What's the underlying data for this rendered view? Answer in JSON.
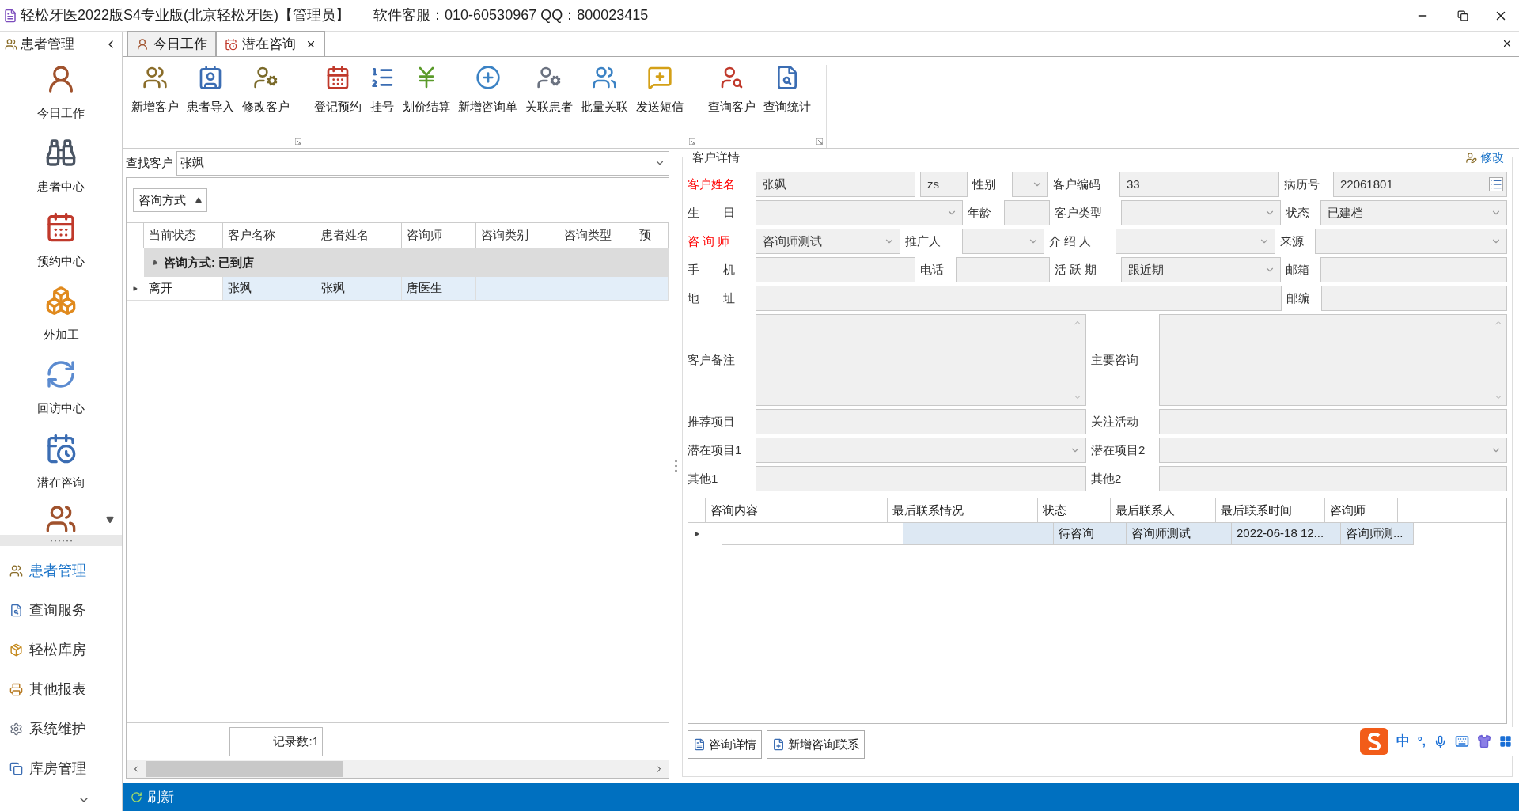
{
  "window": {
    "title": "轻松牙医2022版S4专业版(北京轻松牙医)【管理员】",
    "support": "软件客服：010-60530967 QQ：800023415"
  },
  "sidebar": {
    "title": "患者管理",
    "modules": [
      {
        "label": "今日工作"
      },
      {
        "label": "患者中心"
      },
      {
        "label": "预约中心"
      },
      {
        "label": "外加工"
      },
      {
        "label": "回访中心"
      },
      {
        "label": "潜在咨询"
      }
    ],
    "nav": [
      {
        "label": "患者管理",
        "selected": true
      },
      {
        "label": "查询服务",
        "selected": false
      },
      {
        "label": "轻松库房",
        "selected": false
      },
      {
        "label": "其他报表",
        "selected": false
      },
      {
        "label": "系统维护",
        "selected": false
      },
      {
        "label": "库房管理",
        "selected": false
      }
    ]
  },
  "tabs": [
    {
      "label": "今日工作",
      "selected": false,
      "closable": false
    },
    {
      "label": "潜在咨询",
      "selected": true,
      "closable": true
    }
  ],
  "toolbar": {
    "groups": [
      [
        "新增客户",
        "患者导入",
        "修改客户"
      ],
      [
        "登记预约",
        "挂号",
        "划价结算",
        "新增咨询单",
        "关联患者",
        "批量关联",
        "发送短信"
      ],
      [
        "查询客户",
        "查询统计"
      ]
    ]
  },
  "search": {
    "label": "查找客户",
    "value": "张飒"
  },
  "customer_list": {
    "group_by": "咨询方式",
    "columns": [
      "当前状态",
      "客户名称",
      "患者姓名",
      "咨询师",
      "咨询类别",
      "咨询类型",
      "预"
    ],
    "group": {
      "label": "咨询方式: 已到店",
      "expanded": true
    },
    "rows": [
      {
        "status": "离开",
        "customer": "张飒",
        "patient": "张飒",
        "consultant": "唐医生",
        "selected": true
      }
    ],
    "record_count": "记录数:1"
  },
  "details": {
    "title": "客户详情",
    "edit": "修改",
    "rows": [
      [
        {
          "label": "客户姓名",
          "required": true,
          "kind": "text",
          "value": "张飒",
          "initials": "zs"
        },
        {
          "label": "性别",
          "required": false,
          "kind": "select"
        },
        {
          "label": "客户编码",
          "required": false,
          "kind": "text",
          "value": "33"
        },
        {
          "label": "病历号",
          "required": false,
          "kind": "picker",
          "value": "22061801"
        }
      ],
      [
        {
          "label": "生　　日",
          "required": false,
          "kind": "select"
        },
        {
          "label": "年龄",
          "required": false,
          "kind": "text"
        },
        {
          "label": "客户类型",
          "required": false,
          "kind": "select"
        },
        {
          "label": "状态",
          "required": false,
          "kind": "select",
          "value": "已建档"
        }
      ],
      [
        {
          "label": "咨 询 师",
          "required": true,
          "kind": "select",
          "value": "咨询师测试"
        },
        {
          "label": "推广人",
          "required": false,
          "kind": "select"
        },
        {
          "label": "介 绍 人",
          "required": false,
          "kind": "select"
        },
        {
          "label": "来源",
          "required": false,
          "kind": "select"
        }
      ],
      [
        {
          "label": "手　　机",
          "required": false,
          "kind": "text"
        },
        {
          "label": "电话",
          "required": false,
          "kind": "text"
        },
        {
          "label": "活 跃 期",
          "required": false,
          "kind": "select",
          "value": "跟近期"
        },
        {
          "label": "邮箱",
          "required": false,
          "kind": "text"
        }
      ]
    ],
    "address": [
      {
        "label": "地　　址",
        "required": false,
        "kind": "text"
      },
      {
        "label": "邮编",
        "required": false,
        "kind": "text"
      }
    ],
    "notes": [
      [
        {
          "label": "客户备注",
          "required": false,
          "kind": "textarea"
        },
        {
          "label": "主要咨询",
          "required": false,
          "kind": "textarea"
        }
      ],
      [
        {
          "label": "推荐项目",
          "required": false,
          "kind": "text"
        },
        {
          "label": "关注活动",
          "required": false,
          "kind": "text"
        }
      ],
      [
        {
          "label": "潜在项目1",
          "required": false,
          "kind": "select"
        },
        {
          "label": "潜在项目2",
          "required": false,
          "kind": "select"
        }
      ],
      [
        {
          "label": "其他1",
          "required": false,
          "kind": "text"
        },
        {
          "label": "其他2",
          "required": false,
          "kind": "text"
        }
      ]
    ],
    "history": {
      "columns": [
        "咨询内容",
        "最后联系情况",
        "状态",
        "最后联系人",
        "最后联系时间",
        "咨询师"
      ],
      "rows": [
        {
          "status": "待咨询",
          "contact": "咨询师测试",
          "time": "2022-06-18 12...",
          "consultant": "咨询师测...",
          "selected": true
        }
      ]
    },
    "buttons": [
      "咨询详情",
      "新增咨询联系"
    ]
  },
  "status_bar": {
    "refresh": "刷新"
  },
  "ime": {
    "language": "中",
    "punctuation": "°,"
  }
}
